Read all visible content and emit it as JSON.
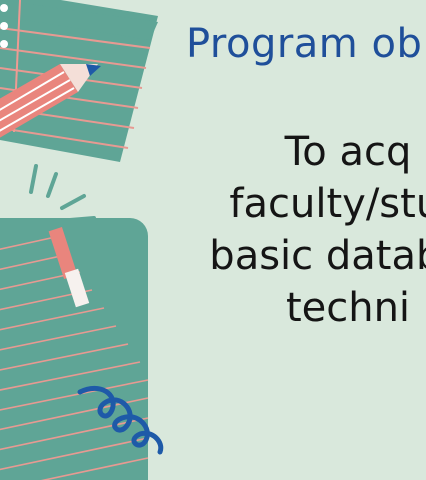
{
  "slide": {
    "title": "Program ob",
    "lines": [
      "To acq",
      "faculty/stud",
      "basic databas",
      "techni"
    ]
  },
  "colors": {
    "background": "#d9e8dc",
    "title": "#1f4f9a",
    "text": "#151515",
    "notepad": "#5fa596",
    "pencil": "#e9857d",
    "spiral": "#1e5aa8"
  },
  "icons": [
    "notepad-icon",
    "pencil-icon",
    "sparkle-icon",
    "notebook-icon",
    "spiral-icon"
  ]
}
